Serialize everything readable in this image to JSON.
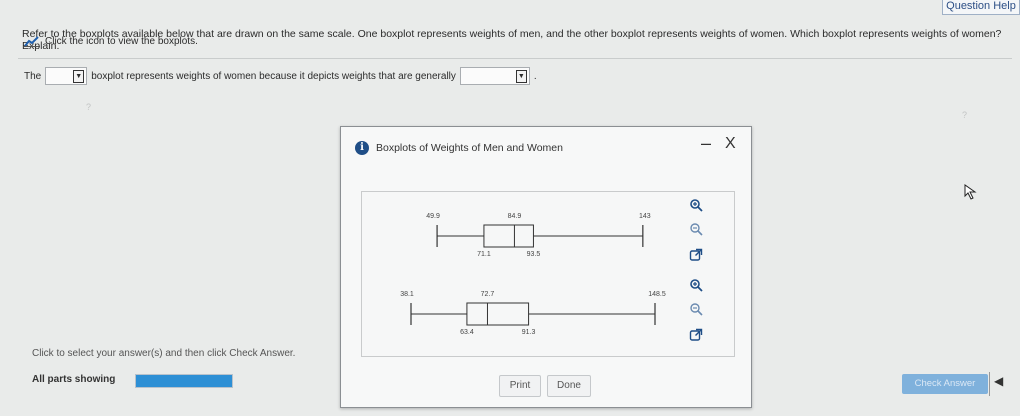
{
  "header": {
    "help_link": "Question Help"
  },
  "question": {
    "text": "Refer to the boxplots available below that are drawn on the same scale. One boxplot represents weights of men, and the other boxplot represents weights of women. Which boxplot represents weights of women? Explain.",
    "icon_link": "Click the icon to view the boxplots."
  },
  "answer": {
    "prefix": "The",
    "middle": "boxplot represents weights of women because it depicts weights that are generally",
    "dropdown1_value": "",
    "dropdown2_value": "",
    "suffix": "."
  },
  "dialog": {
    "title": "Boxplots of Weights of Men and Women",
    "minimize_label": "–",
    "close_label": "X",
    "print_label": "Print",
    "done_label": "Done"
  },
  "chart_data": {
    "type": "boxplot",
    "series": [
      {
        "min": 49.9,
        "q1": 71.1,
        "median": 84.9,
        "q3": 93.5,
        "max": 143,
        "labels": {
          "min": "49.9",
          "q1": "71.1",
          "median": "84.9",
          "q3": "93.5",
          "max": "143"
        }
      },
      {
        "min": 38.1,
        "q1": 63.4,
        "median": 72.7,
        "q3": 91.3,
        "max": 148.5,
        "labels": {
          "min": "38.1",
          "q1": "63.4",
          "median": "72.7",
          "q3": "91.3",
          "max": "148.5"
        }
      }
    ],
    "xlim": [
      38.1,
      148.5
    ]
  },
  "side_icons": [
    "zoom-in-icon",
    "zoom-out-icon",
    "popout-icon",
    "zoom-in-icon",
    "zoom-out-icon",
    "popout-icon"
  ],
  "footer": {
    "help_text": "Click to select your answer(s) and then click Check Answer.",
    "parts_label": "All parts showing",
    "progress": 1.0,
    "check_answer_label": "Check Answer"
  },
  "faint_marks": {
    "left": "?",
    "right": "?"
  },
  "colors": {
    "accent": "#1f4e87",
    "progress": "#2d8fd5",
    "check_button": "#7fb1dc"
  }
}
